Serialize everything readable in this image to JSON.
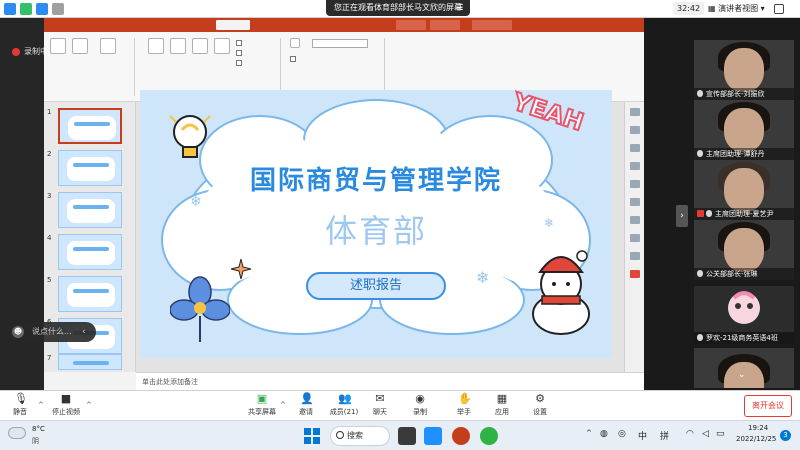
{
  "meeting_bar": {
    "share_banner": "您正在观看体育部部长马文欣的屏幕",
    "timer": "32:42",
    "view_label": "演讲者视图",
    "view_caret": "▾"
  },
  "recording": {
    "label": "录制中"
  },
  "slide": {
    "title": "国际商贸与管理学院",
    "subtitle": "体育部",
    "pill_text": "述职报告",
    "deco_text": "YEAH"
  },
  "thumbnails": {
    "numbers": [
      "1",
      "2",
      "3",
      "4",
      "5",
      "6",
      "7"
    ]
  },
  "notes": {
    "placeholder": "单击此处添加备注"
  },
  "chat_toast": {
    "text": "说点什么...",
    "avatar_glyph": "☻",
    "close_glyph": "‹"
  },
  "participants": [
    {
      "name": "宣传部部长-刘振欣",
      "muted": false
    },
    {
      "name": "主席团助理-谭舒丹",
      "muted": false
    },
    {
      "name": "主席团助理-夏艺尹",
      "muted": true
    },
    {
      "name": "公关部部长-张琳",
      "muted": false
    },
    {
      "name": "罗欢-21级商务英语4班",
      "muted": false
    },
    {
      "name": "",
      "muted": false
    }
  ],
  "controls": {
    "mute": {
      "label": "静音",
      "icon": "mic-icon"
    },
    "video": {
      "label": "停止视频",
      "icon": "camera-icon"
    },
    "share": {
      "label": "共享屏幕",
      "icon": "share-screen-icon"
    },
    "invite": {
      "label": "邀请",
      "icon": "invite-icon"
    },
    "members": {
      "label": "成员(21)",
      "icon": "members-icon"
    },
    "chat": {
      "label": "聊天",
      "icon": "chat-icon"
    },
    "record": {
      "label": "录制",
      "icon": "record-icon"
    },
    "raise": {
      "label": "举手",
      "icon": "hand-icon"
    },
    "apps": {
      "label": "应用",
      "icon": "apps-icon"
    },
    "settings": {
      "label": "设置",
      "icon": "gear-icon"
    },
    "leave": "离开会议",
    "caret": "^"
  },
  "taskbar": {
    "weather_temp": "8°C",
    "weather_desc": "阴",
    "search_label": "搜索",
    "tray_lang": "中",
    "tray_ime": "拼",
    "time": "19:24",
    "date": "2022/12/25",
    "notif_count": "3",
    "tray_caret": "^"
  },
  "colors": {
    "ppt_accent": "#c43e1c",
    "slide_blue": "#2a8ae0",
    "leave_red": "#e53935",
    "windows_blue": "#0078d4"
  }
}
